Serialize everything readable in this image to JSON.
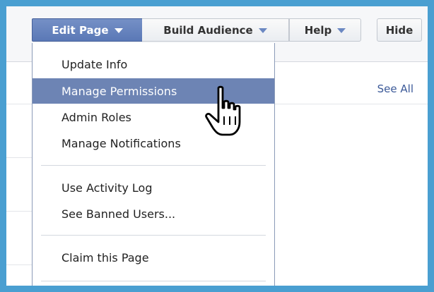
{
  "toolbar": {
    "edit_page": "Edit Page",
    "build_audience": "Build Audience",
    "help": "Help",
    "hide": "Hide"
  },
  "content": {
    "see_all": "See All"
  },
  "dropdown": {
    "items": [
      {
        "label": "Update Info"
      },
      {
        "label": "Manage Permissions",
        "state": "hovered"
      },
      {
        "label": "Admin Roles"
      },
      {
        "label": "Manage Notifications"
      },
      {
        "label": "Use Activity Log"
      },
      {
        "label": "See Banned Users..."
      },
      {
        "label": "Claim this Page"
      }
    ]
  },
  "colors": {
    "frame_border": "#4a9fd1",
    "accent": "#6d84b4",
    "link": "#3b5998"
  },
  "cursor": {
    "icon": "hand-pointer-icon"
  }
}
